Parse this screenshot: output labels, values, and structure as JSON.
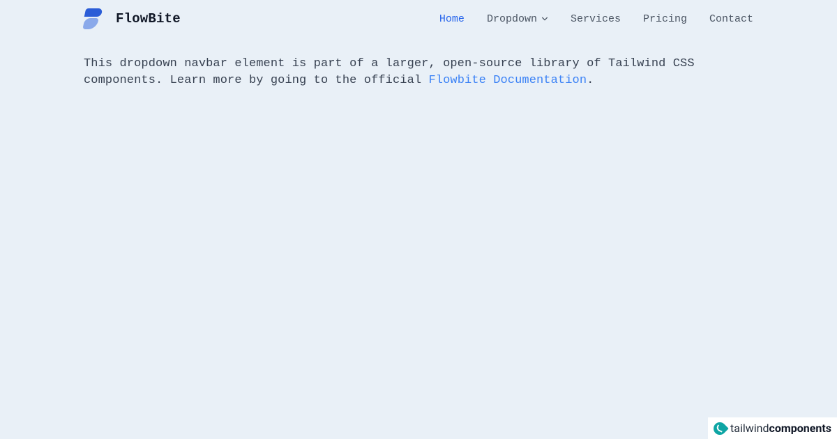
{
  "brand": {
    "name": "FlowBite"
  },
  "nav": {
    "home": "Home",
    "dropdown": "Dropdown",
    "services": "Services",
    "pricing": "Pricing",
    "contact": "Contact"
  },
  "content": {
    "text1": "This dropdown navbar element is part of a larger, open-source library of Tailwind CSS components. Learn more by going to the official ",
    "link_text": "Flowbite Documentation",
    "text2": "."
  },
  "footer": {
    "word1": "tailwind",
    "word2": "components"
  }
}
